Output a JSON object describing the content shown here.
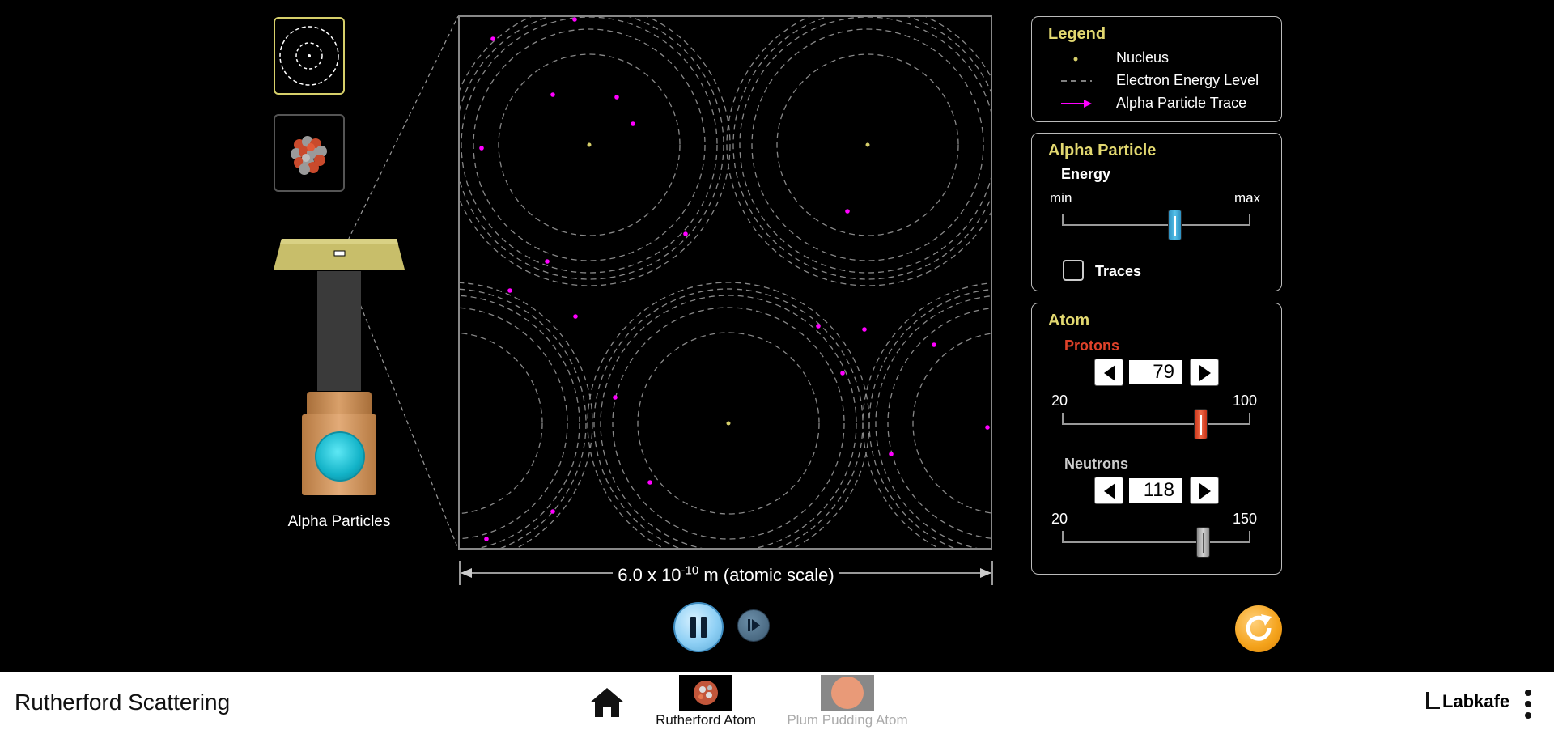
{
  "app": {
    "title": "Rutherford Scattering",
    "brand": "Labkafe"
  },
  "colors": {
    "accent_title": "#e2d870",
    "alpha_trace": "#ff00ff",
    "nucleus": "#d6cf6a",
    "protons": "#e0422a",
    "energy_thumb": "#36a3d0"
  },
  "view_selector": {
    "options": [
      "atomic-view-icon",
      "nuclear-view-icon"
    ],
    "selected": "atomic"
  },
  "gun": {
    "label": "Alpha Particles"
  },
  "scale": {
    "base": "6.0 x 10",
    "exponent": "-10",
    "unit": " m (atomic scale)"
  },
  "legend": {
    "title": "Legend",
    "items": [
      {
        "icon": "nucleus-dot-icon",
        "label": "Nucleus"
      },
      {
        "icon": "dashed-line-icon",
        "label": "Electron Energy Level"
      },
      {
        "icon": "arrow-trace-icon",
        "label": "Alpha Particle Trace"
      }
    ]
  },
  "alpha_particle": {
    "title": "Alpha Particle",
    "energy_label": "Energy",
    "min_label": "min",
    "max_label": "max",
    "energy_fraction": 0.6,
    "traces_label": "Traces",
    "traces_checked": false
  },
  "atom": {
    "title": "Atom",
    "protons": {
      "label": "Protons",
      "value": "79",
      "min": "20",
      "max": "100",
      "fraction": 0.7375
    },
    "neutrons": {
      "label": "Neutrons",
      "value": "118",
      "min": "20",
      "max": "150",
      "fraction": 0.754
    }
  },
  "screens": [
    {
      "label": "Rutherford Atom",
      "selected": true
    },
    {
      "label": "Plum Pudding Atom",
      "selected": false
    }
  ]
}
